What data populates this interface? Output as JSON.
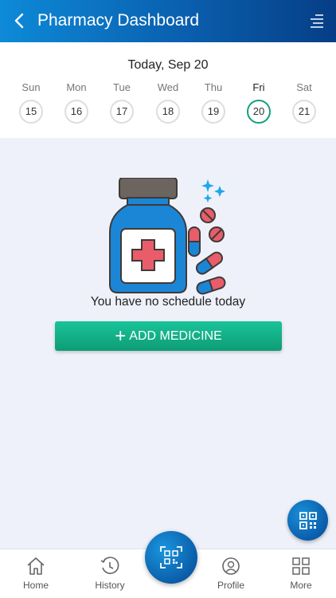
{
  "header": {
    "title": "Pharmacy Dashboard",
    "back_icon": "chevron-left-icon",
    "menu_icon": "menu-lines-icon"
  },
  "calendar": {
    "title": "Today, Sep 20",
    "days": [
      {
        "name": "Sun",
        "num": "15"
      },
      {
        "name": "Mon",
        "num": "16"
      },
      {
        "name": "Tue",
        "num": "17"
      },
      {
        "name": "Wed",
        "num": "18"
      },
      {
        "name": "Thu",
        "num": "19"
      },
      {
        "name": "Fri",
        "num": "20"
      },
      {
        "name": "Sat",
        "num": "21"
      }
    ],
    "selected_day": "20"
  },
  "empty_state": {
    "message": "You have no schedule today",
    "illustration": "medicine-bottle-with-pills"
  },
  "add_button": {
    "label": "ADD MEDICINE"
  },
  "fab": {
    "icon": "qr-code-icon"
  },
  "nav": {
    "home": "Home",
    "history": "History",
    "profile": "Profile",
    "more": "More",
    "center_icon": "qr-scan-icon"
  },
  "colors": {
    "header_start": "#0d8ad8",
    "header_end": "#063e86",
    "accent_green": "#11a07c",
    "background": "#eef1f9"
  }
}
